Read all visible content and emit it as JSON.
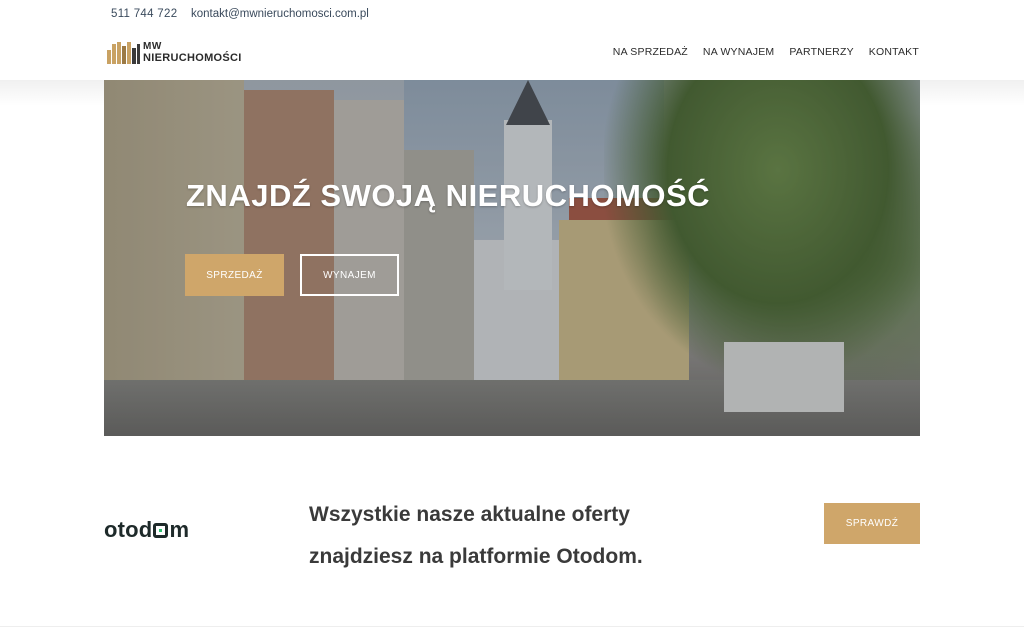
{
  "topbar": {
    "phone": "511 744 722",
    "email": "kontakt@mwnieruchomosci.com.pl"
  },
  "logo": {
    "line1": "MW",
    "line2": "NIERUCHOMOŚCI",
    "icon": "buildings-logo-icon"
  },
  "nav": {
    "items": [
      {
        "label": "NA SPRZEDAŻ"
      },
      {
        "label": "NA WYNAJEM"
      },
      {
        "label": "PARTNERZY"
      },
      {
        "label": "KONTAKT"
      }
    ]
  },
  "hero": {
    "title": "ZNAJDŹ SWOJĄ NIERUCHOMOŚĆ",
    "btn_sale": "SPRZEDAŻ",
    "btn_rent": "WYNAJEM"
  },
  "otodom": {
    "logo_text_a": "otod",
    "logo_text_b": "m",
    "promo_line1": "Wszystkie nasze aktualne oferty",
    "promo_line2": "znajdziesz na platformie Otodom.",
    "btn_check": "SPRAWDŹ"
  },
  "colors": {
    "accent_gold": "#cfa66a",
    "text_dark": "#2b2b2b",
    "otodom_green": "#2fbf71"
  }
}
